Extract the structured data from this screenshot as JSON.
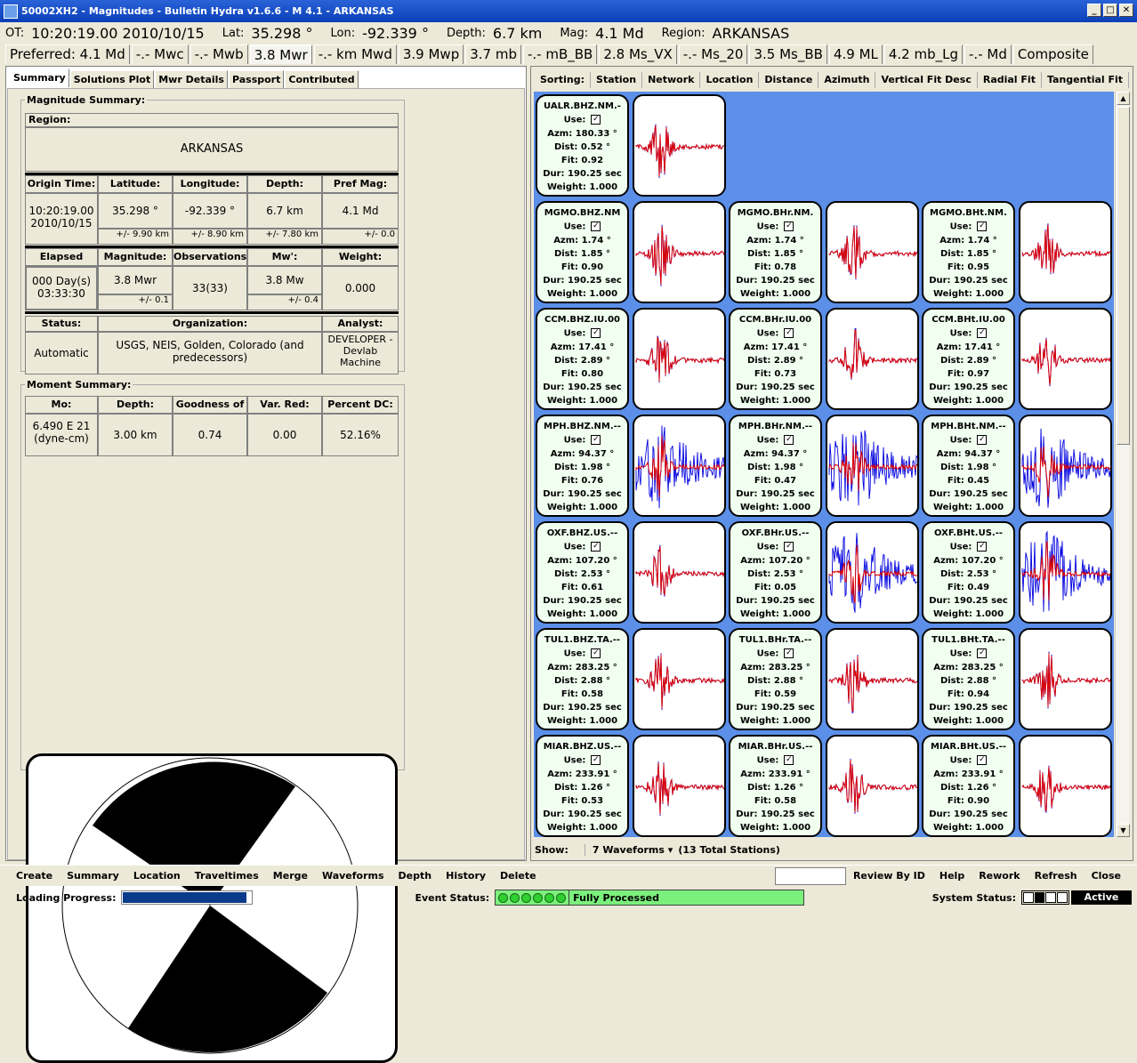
{
  "window": {
    "title": "50002XH2 - Magnitudes - Bulletin Hydra v1.6.6 - M 4.1 - ARKANSAS",
    "min": "_",
    "max": "□",
    "close": "✕"
  },
  "info": {
    "ot_label": "OT:",
    "ot": "10:20:19.00 2010/10/15",
    "lat_label": "Lat:",
    "lat": "35.298 °",
    "lon_label": "Lon:",
    "lon": "-92.339 °",
    "depth_label": "Depth:",
    "depth": "6.7 km",
    "mag_label": "Mag:",
    "mag": "4.1 Md",
    "region_label": "Region:",
    "region": "ARKANSAS"
  },
  "mag_tabs": [
    "Preferred: 4.1 Md",
    "-.- Mwc",
    "-.- Mwb",
    "3.8 Mwr",
    "-.- km Mwd",
    "3.9 Mwp",
    "3.7 mb",
    "-.- mB_BB",
    "2.8 Ms_VX",
    "-.- Ms_20",
    "3.5 Ms_BB",
    "4.9 ML",
    "4.2 mb_Lg",
    "-.- Md",
    "Composite"
  ],
  "left_tabs": [
    "Summary",
    "Solutions Plot",
    "Mwr Details",
    "Passport",
    "Contributed"
  ],
  "summary": {
    "legend": "Magnitude Summary:",
    "region_label": "Region:",
    "region": "ARKANSAS",
    "h1": [
      "Origin Time:",
      "Latitude:",
      "Longitude:",
      "Depth:",
      "Pref Mag:"
    ],
    "origin_time": "10:20:19.00 2010/10/15",
    "lat": "35.298 °",
    "lat_err": "+/- 9.90 km",
    "lon": "-92.339 °",
    "lon_err": "+/- 8.90 km",
    "depth": "6.7 km",
    "depth_err": "+/- 7.80 km",
    "pref_mag": "4.1 Md",
    "pref_err": "+/- 0.0",
    "h2": [
      "Elapsed",
      "Magnitude:",
      "Observations",
      "Mw':",
      "Weight:"
    ],
    "elapsed": "000 Day(s) 03:33:30",
    "magnitude": "3.8 Mwr",
    "mag_err": "+/- 0.1",
    "observations": "33(33)",
    "mwp": "3.8 Mw",
    "mwp_err": "+/- 0.4",
    "weight": "0.000",
    "h3": [
      "Status:",
      "Organization:",
      "Analyst:"
    ],
    "status": "Automatic",
    "organization": "USGS, NEIS, Golden, Colorado (and predecessors)",
    "analyst": "DEVELOPER - Devlab Machine"
  },
  "moment": {
    "legend": "Moment Summary:",
    "h": [
      "Mo:",
      "Depth:",
      "Goodness of",
      "Var. Red:",
      "Percent DC:"
    ],
    "mo": "6.490 E 21 (dyne-cm)",
    "depth": "3.00 km",
    "goodness": "0.74",
    "varred": "0.00",
    "pdc": "52.16%"
  },
  "sorting": [
    "Sorting:",
    "Station",
    "Network",
    "Location",
    "Distance",
    "Azimuth",
    "Vertical Fit Desc",
    "Radial Fit",
    "Tangential Fit"
  ],
  "labels": {
    "use": "Use:",
    "azm": "Azm:",
    "dist": "Dist:",
    "fit": "Fit:",
    "dur": "Dur:",
    "weight": "Weight:",
    "check": "✓"
  },
  "stations": [
    {
      "row": 0,
      "col": 0,
      "sta": "UALR.BHZ.NM.-",
      "azm": "180.33 °",
      "dist": "0.52 °",
      "fit": "0.92",
      "dur": "190.25 sec",
      "w": "1.000"
    },
    {
      "row": 1,
      "col": 0,
      "sta": "MGMO.BHZ.NM",
      "azm": "1.74 °",
      "dist": "1.85 °",
      "fit": "0.90",
      "dur": "190.25 sec",
      "w": "1.000"
    },
    {
      "row": 1,
      "col": 1,
      "sta": "MGMO.BHr.NM.",
      "azm": "1.74 °",
      "dist": "1.85 °",
      "fit": "0.78",
      "dur": "190.25 sec",
      "w": "1.000"
    },
    {
      "row": 1,
      "col": 2,
      "sta": "MGMO.BHt.NM.",
      "azm": "1.74 °",
      "dist": "1.85 °",
      "fit": "0.95",
      "dur": "190.25 sec",
      "w": "1.000"
    },
    {
      "row": 2,
      "col": 0,
      "sta": "CCM.BHZ.IU.00",
      "azm": "17.41 °",
      "dist": "2.89 °",
      "fit": "0.80",
      "dur": "190.25 sec",
      "w": "1.000"
    },
    {
      "row": 2,
      "col": 1,
      "sta": "CCM.BHr.IU.00",
      "azm": "17.41 °",
      "dist": "2.89 °",
      "fit": "0.73",
      "dur": "190.25 sec",
      "w": "1.000"
    },
    {
      "row": 2,
      "col": 2,
      "sta": "CCM.BHt.IU.00",
      "azm": "17.41 °",
      "dist": "2.89 °",
      "fit": "0.97",
      "dur": "190.25 sec",
      "w": "1.000"
    },
    {
      "row": 3,
      "col": 0,
      "sta": "MPH.BHZ.NM.--",
      "azm": "94.37 °",
      "dist": "1.98 °",
      "fit": "0.76",
      "dur": "190.25 sec",
      "w": "1.000"
    },
    {
      "row": 3,
      "col": 1,
      "sta": "MPH.BHr.NM.--",
      "azm": "94.37 °",
      "dist": "1.98 °",
      "fit": "0.47",
      "dur": "190.25 sec",
      "w": "1.000"
    },
    {
      "row": 3,
      "col": 2,
      "sta": "MPH.BHt.NM.--",
      "azm": "94.37 °",
      "dist": "1.98 °",
      "fit": "0.45",
      "dur": "190.25 sec",
      "w": "1.000"
    },
    {
      "row": 4,
      "col": 0,
      "sta": "OXF.BHZ.US.--",
      "azm": "107.20 °",
      "dist": "2.53 °",
      "fit": "0.61",
      "dur": "190.25 sec",
      "w": "1.000"
    },
    {
      "row": 4,
      "col": 1,
      "sta": "OXF.BHr.US.--",
      "azm": "107.20 °",
      "dist": "2.53 °",
      "fit": "0.05",
      "dur": "190.25 sec",
      "w": "1.000"
    },
    {
      "row": 4,
      "col": 2,
      "sta": "OXF.BHt.US.--",
      "azm": "107.20 °",
      "dist": "2.53 °",
      "fit": "0.49",
      "dur": "190.25 sec",
      "w": "1.000"
    },
    {
      "row": 5,
      "col": 0,
      "sta": "TUL1.BHZ.TA.--",
      "azm": "283.25 °",
      "dist": "2.88 °",
      "fit": "0.58",
      "dur": "190.25 sec",
      "w": "1.000"
    },
    {
      "row": 5,
      "col": 1,
      "sta": "TUL1.BHr.TA.--",
      "azm": "283.25 °",
      "dist": "2.88 °",
      "fit": "0.59",
      "dur": "190.25 sec",
      "w": "1.000"
    },
    {
      "row": 5,
      "col": 2,
      "sta": "TUL1.BHt.TA.--",
      "azm": "283.25 °",
      "dist": "2.88 °",
      "fit": "0.94",
      "dur": "190.25 sec",
      "w": "1.000"
    },
    {
      "row": 6,
      "col": 0,
      "sta": "MIAR.BHZ.US.--",
      "azm": "233.91 °",
      "dist": "1.26 °",
      "fit": "0.53",
      "dur": "190.25 sec",
      "w": "1.000"
    },
    {
      "row": 6,
      "col": 1,
      "sta": "MIAR.BHr.US.--",
      "azm": "233.91 °",
      "dist": "1.26 °",
      "fit": "0.58",
      "dur": "190.25 sec",
      "w": "1.000"
    },
    {
      "row": 6,
      "col": 2,
      "sta": "MIAR.BHt.US.--",
      "azm": "233.91 °",
      "dist": "1.26 °",
      "fit": "0.90",
      "dur": "190.25 sec",
      "w": "1.000"
    }
  ],
  "show": {
    "label": "Show:",
    "value": "7 Waveforms",
    "total": "(13 Total Stations)"
  },
  "bottom_buttons": [
    "Create",
    "Summary",
    "Location",
    "Traveltimes",
    "Merge",
    "Waveforms",
    "Depth",
    "History",
    "Delete"
  ],
  "right_buttons": [
    "Review By ID",
    "Help",
    "Rework",
    "Refresh",
    "Close"
  ],
  "status": {
    "loading_label": "Loading Progress:",
    "loading_fraction": 0.95,
    "event_label": "Event Status:",
    "event": "Fully Processed",
    "system_label": "System Status:",
    "system": "Active"
  },
  "colors": {
    "title": "#0a3fb8",
    "grid": "#5b8fe8",
    "synthetic": "#e00000",
    "observed": "#0000e0",
    "status_green": "#7cf07c"
  }
}
